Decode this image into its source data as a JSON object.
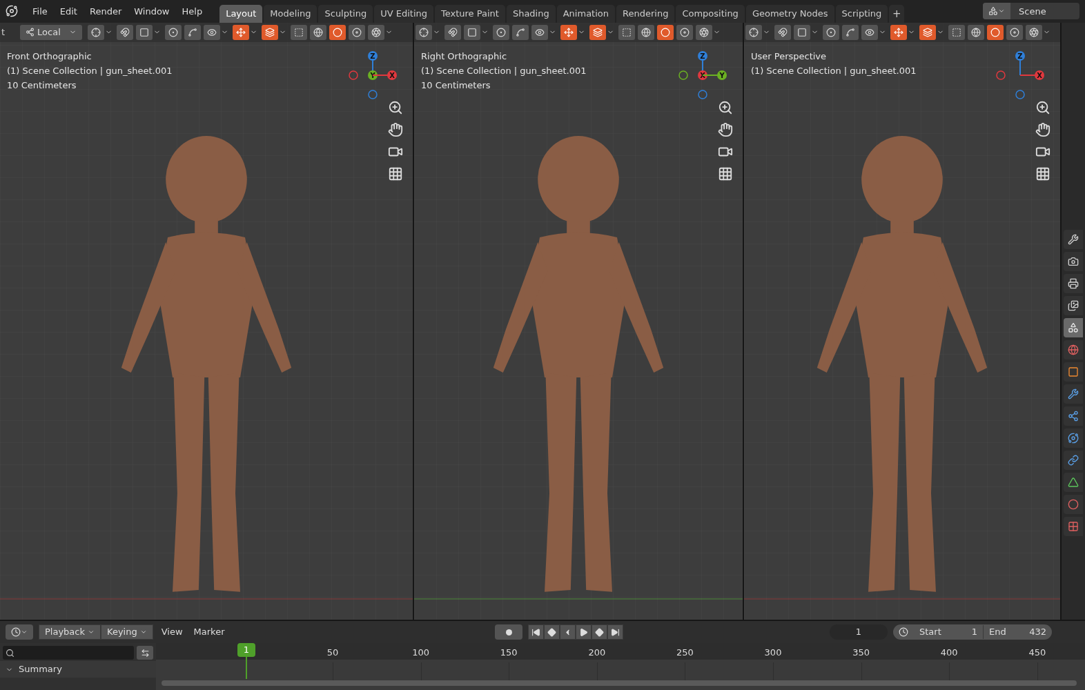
{
  "menu": [
    "File",
    "Edit",
    "Render",
    "Window",
    "Help"
  ],
  "workspaces": [
    {
      "label": "Layout",
      "selected": true
    },
    {
      "label": "Modeling",
      "selected": false
    },
    {
      "label": "Sculpting",
      "selected": false
    },
    {
      "label": "UV Editing",
      "selected": false
    },
    {
      "label": "Texture Paint",
      "selected": false
    },
    {
      "label": "Shading",
      "selected": false
    },
    {
      "label": "Animation",
      "selected": false
    },
    {
      "label": "Rendering",
      "selected": false
    },
    {
      "label": "Compositing",
      "selected": false
    },
    {
      "label": "Geometry Nodes",
      "selected": false
    },
    {
      "label": "Scripting",
      "selected": false
    }
  ],
  "add_tab": "+",
  "scene": "Scene",
  "viewports": [
    {
      "header_lead": "t",
      "orientation": "Local",
      "tools": [
        {
          "kind": "pivot",
          "on": false
        },
        {
          "kind": "snap",
          "on": false
        },
        {
          "kind": "snap-target",
          "on": false
        },
        {
          "kind": "proportional",
          "on": false
        },
        {
          "kind": "falloff",
          "on": false
        },
        {
          "kind": "visibility",
          "on": false
        },
        {
          "kind": "gizmo",
          "on": true
        },
        {
          "kind": "overlay",
          "on": true
        },
        {
          "kind": "xray",
          "on": false
        },
        {
          "kind": "wireframe",
          "on": false
        },
        {
          "kind": "solid",
          "on": true
        },
        {
          "kind": "material",
          "on": false
        },
        {
          "kind": "rendered",
          "on": false
        }
      ],
      "overlay_lines": [
        "Front Orthographic",
        "(1) Scene Collection | gun_sheet.001",
        "10 Centimeters"
      ],
      "gizmo": [
        {
          "label": "Z",
          "color": "#2f7fd8",
          "kind": "up"
        },
        {
          "label": "Y",
          "color": "#6bb022",
          "kind": "center"
        },
        {
          "label": "X",
          "color": "#e0383e",
          "kind": "right"
        }
      ]
    },
    {
      "tools": [
        {
          "kind": "pivot",
          "on": false
        },
        {
          "kind": "snap",
          "on": false
        },
        {
          "kind": "snap-target",
          "on": false
        },
        {
          "kind": "proportional",
          "on": false
        },
        {
          "kind": "falloff",
          "on": false
        },
        {
          "kind": "visibility",
          "on": false
        },
        {
          "kind": "gizmo",
          "on": true
        },
        {
          "kind": "overlay",
          "on": true
        },
        {
          "kind": "xray",
          "on": false
        },
        {
          "kind": "wireframe",
          "on": false
        },
        {
          "kind": "solid",
          "on": true
        },
        {
          "kind": "material",
          "on": false
        },
        {
          "kind": "rendered",
          "on": false
        }
      ],
      "overlay_lines": [
        "Right Orthographic",
        "(1) Scene Collection | gun_sheet.001",
        "10 Centimeters"
      ],
      "gizmo": [
        {
          "label": "Z",
          "color": "#2f7fd8",
          "kind": "up"
        },
        {
          "label": "X",
          "color": "#e0383e",
          "kind": "center"
        },
        {
          "label": "Y",
          "color": "#6bb022",
          "kind": "right"
        }
      ]
    },
    {
      "tools": [
        {
          "kind": "pivot",
          "on": false
        },
        {
          "kind": "snap",
          "on": false
        },
        {
          "kind": "snap-target",
          "on": false
        },
        {
          "kind": "proportional",
          "on": false
        },
        {
          "kind": "falloff",
          "on": false
        },
        {
          "kind": "visibility",
          "on": false
        },
        {
          "kind": "gizmo",
          "on": true
        },
        {
          "kind": "overlay",
          "on": true
        },
        {
          "kind": "xray",
          "on": false
        },
        {
          "kind": "wireframe",
          "on": false
        },
        {
          "kind": "solid",
          "on": true
        },
        {
          "kind": "material",
          "on": false
        },
        {
          "kind": "rendered",
          "on": false
        }
      ],
      "overlay_lines": [
        "User Perspective",
        "(1) Scene Collection | gun_sheet.001"
      ],
      "gizmo": [
        {
          "label": "Z",
          "color": "#2f7fd8",
          "kind": "up"
        },
        {
          "label": "X",
          "color": "#e0383e",
          "kind": "right"
        }
      ]
    }
  ],
  "properties_tabs": [
    {
      "kind": "tool",
      "selected": false
    },
    {
      "kind": "render",
      "selected": false
    },
    {
      "kind": "output",
      "selected": false
    },
    {
      "kind": "view-layer",
      "selected": false
    },
    {
      "kind": "scene",
      "selected": true
    },
    {
      "kind": "world",
      "selected": false
    },
    {
      "kind": "object",
      "selected": false
    },
    {
      "kind": "modifier",
      "selected": false
    },
    {
      "kind": "particles",
      "selected": false
    },
    {
      "kind": "physics",
      "selected": false
    },
    {
      "kind": "constraints",
      "selected": false
    },
    {
      "kind": "data",
      "selected": false
    },
    {
      "kind": "material",
      "selected": false
    },
    {
      "kind": "texture",
      "selected": false
    }
  ],
  "timeline": {
    "dropdowns": [
      "Playback",
      "Keying"
    ],
    "menus": [
      "View",
      "Marker"
    ],
    "auto_key": false,
    "current_frame": "1",
    "start_label": "Start",
    "start": "1",
    "end_label": "End",
    "end": "432",
    "playhead": "1",
    "ruler": [
      "50",
      "100",
      "150",
      "200",
      "250",
      "300",
      "350",
      "400",
      "450"
    ],
    "summary": {
      "label": "Summary",
      "expanded": true
    }
  }
}
